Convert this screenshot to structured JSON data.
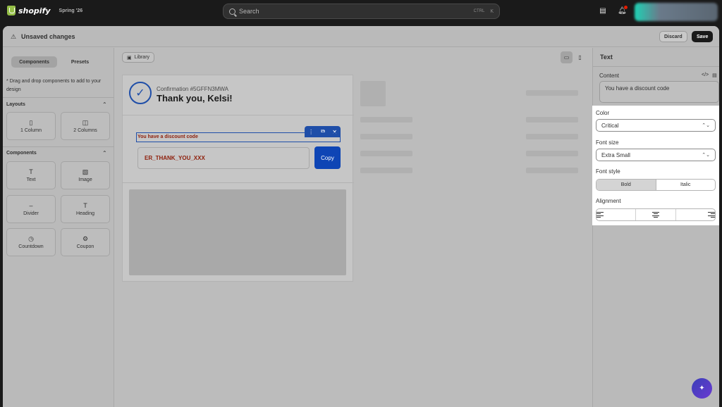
{
  "topbar": {
    "brand": "shopify",
    "edition": "Spring '26",
    "search_placeholder": "Search",
    "search_shortcut": "CTRL",
    "search_shortcut_key": "K"
  },
  "editor": {
    "title": "Unsaved changes",
    "discard_label": "Discard",
    "save_label": "Save"
  },
  "left_panel": {
    "tabs": [
      {
        "label": "Components",
        "active": true
      },
      {
        "label": "Presets",
        "active": false
      }
    ],
    "hint": "* Drag and drop components to add to your design",
    "layouts_title": "Layouts",
    "layouts": [
      {
        "label": "1 Column",
        "icon": "single-column-icon"
      },
      {
        "label": "2 Columns",
        "icon": "two-columns-icon"
      }
    ],
    "components_title": "Components",
    "components": [
      {
        "label": "Text",
        "icon": "text-icon"
      },
      {
        "label": "Image",
        "icon": "image-icon"
      },
      {
        "label": "Divider",
        "icon": "divider-icon"
      },
      {
        "label": "Heading",
        "icon": "heading-icon"
      },
      {
        "label": "Countdown",
        "icon": "clock-icon"
      },
      {
        "label": "Coupon",
        "icon": "coupon-icon"
      }
    ]
  },
  "canvas": {
    "library_label": "Library",
    "confirmation": "Confirmation #5GFFN3MWA",
    "thank_you": "Thank you, Kelsi!",
    "coupon_text": "You have a discount code",
    "coupon_code": "ER_THANK_YOU_XXX",
    "copy_label": "Copy"
  },
  "right_panel": {
    "title": "Text",
    "content_label": "Content",
    "content_value": "You have a discount code",
    "color_label": "Color",
    "color_value": "Critical",
    "font_size_label": "Font size",
    "font_size_value": "Extra Small",
    "font_style_label": "Font style",
    "font_styles": [
      {
        "label": "Bold",
        "active": true
      },
      {
        "label": "Italic",
        "active": false
      }
    ],
    "alignment_label": "Alignment",
    "alignments": [
      "align-left-icon",
      "align-center-icon",
      "align-right-icon"
    ]
  },
  "colors": {
    "accent": "#1f4ea8",
    "critical_text": "#8e1f0b",
    "copy_button": "#0e45b5"
  }
}
